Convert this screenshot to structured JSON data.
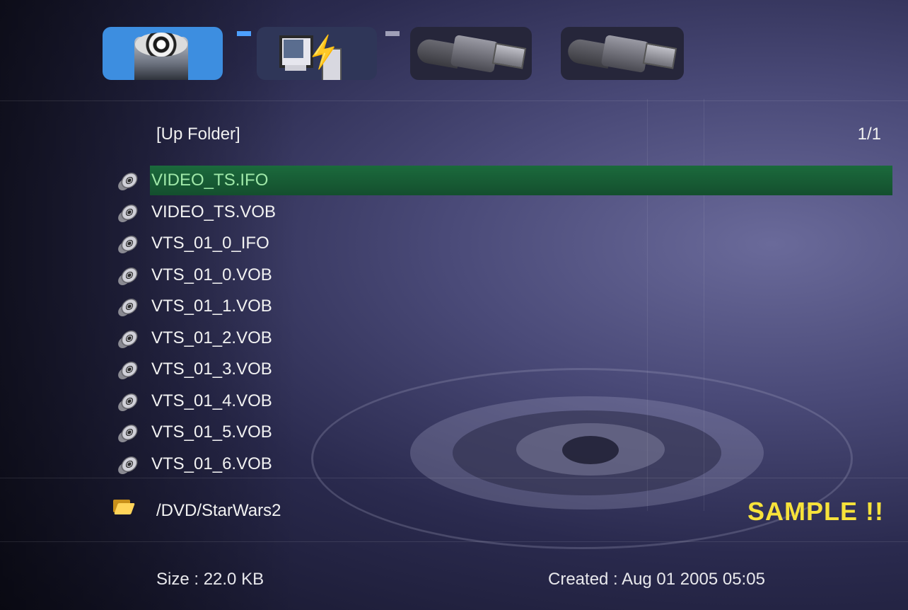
{
  "devices": [
    {
      "name": "disc-drive",
      "icon": "disc-drive-icon",
      "active": true
    },
    {
      "name": "pc-network",
      "icon": "pc-network-icon",
      "active": false
    },
    {
      "name": "usb-1",
      "icon": "usb-icon",
      "active": false
    },
    {
      "name": "usb-2",
      "icon": "usb-icon",
      "active": false
    }
  ],
  "list": {
    "up_folder": "[Up Folder]",
    "page": "1/1",
    "selected_index": 0,
    "files": [
      "VIDEO_TS.IFO",
      "VIDEO_TS.VOB",
      "VTS_01_0_IFO",
      "VTS_01_0.VOB",
      "VTS_01_1.VOB",
      "VTS_01_2.VOB",
      "VTS_01_3.VOB",
      "VTS_01_4.VOB",
      "VTS_01_5.VOB",
      "VTS_01_6.VOB"
    ]
  },
  "path": "/DVD/StarWars2",
  "watermark": "SAMPLE !!",
  "footer": {
    "size": "Size : 22.0 KB",
    "created": "Created : Aug 01 2005 05:05"
  },
  "colors": {
    "selection": "#1b6a3c",
    "selected_text": "#9fe8a8",
    "watermark": "#f7e23a",
    "active_device": "#3d8ee0"
  }
}
